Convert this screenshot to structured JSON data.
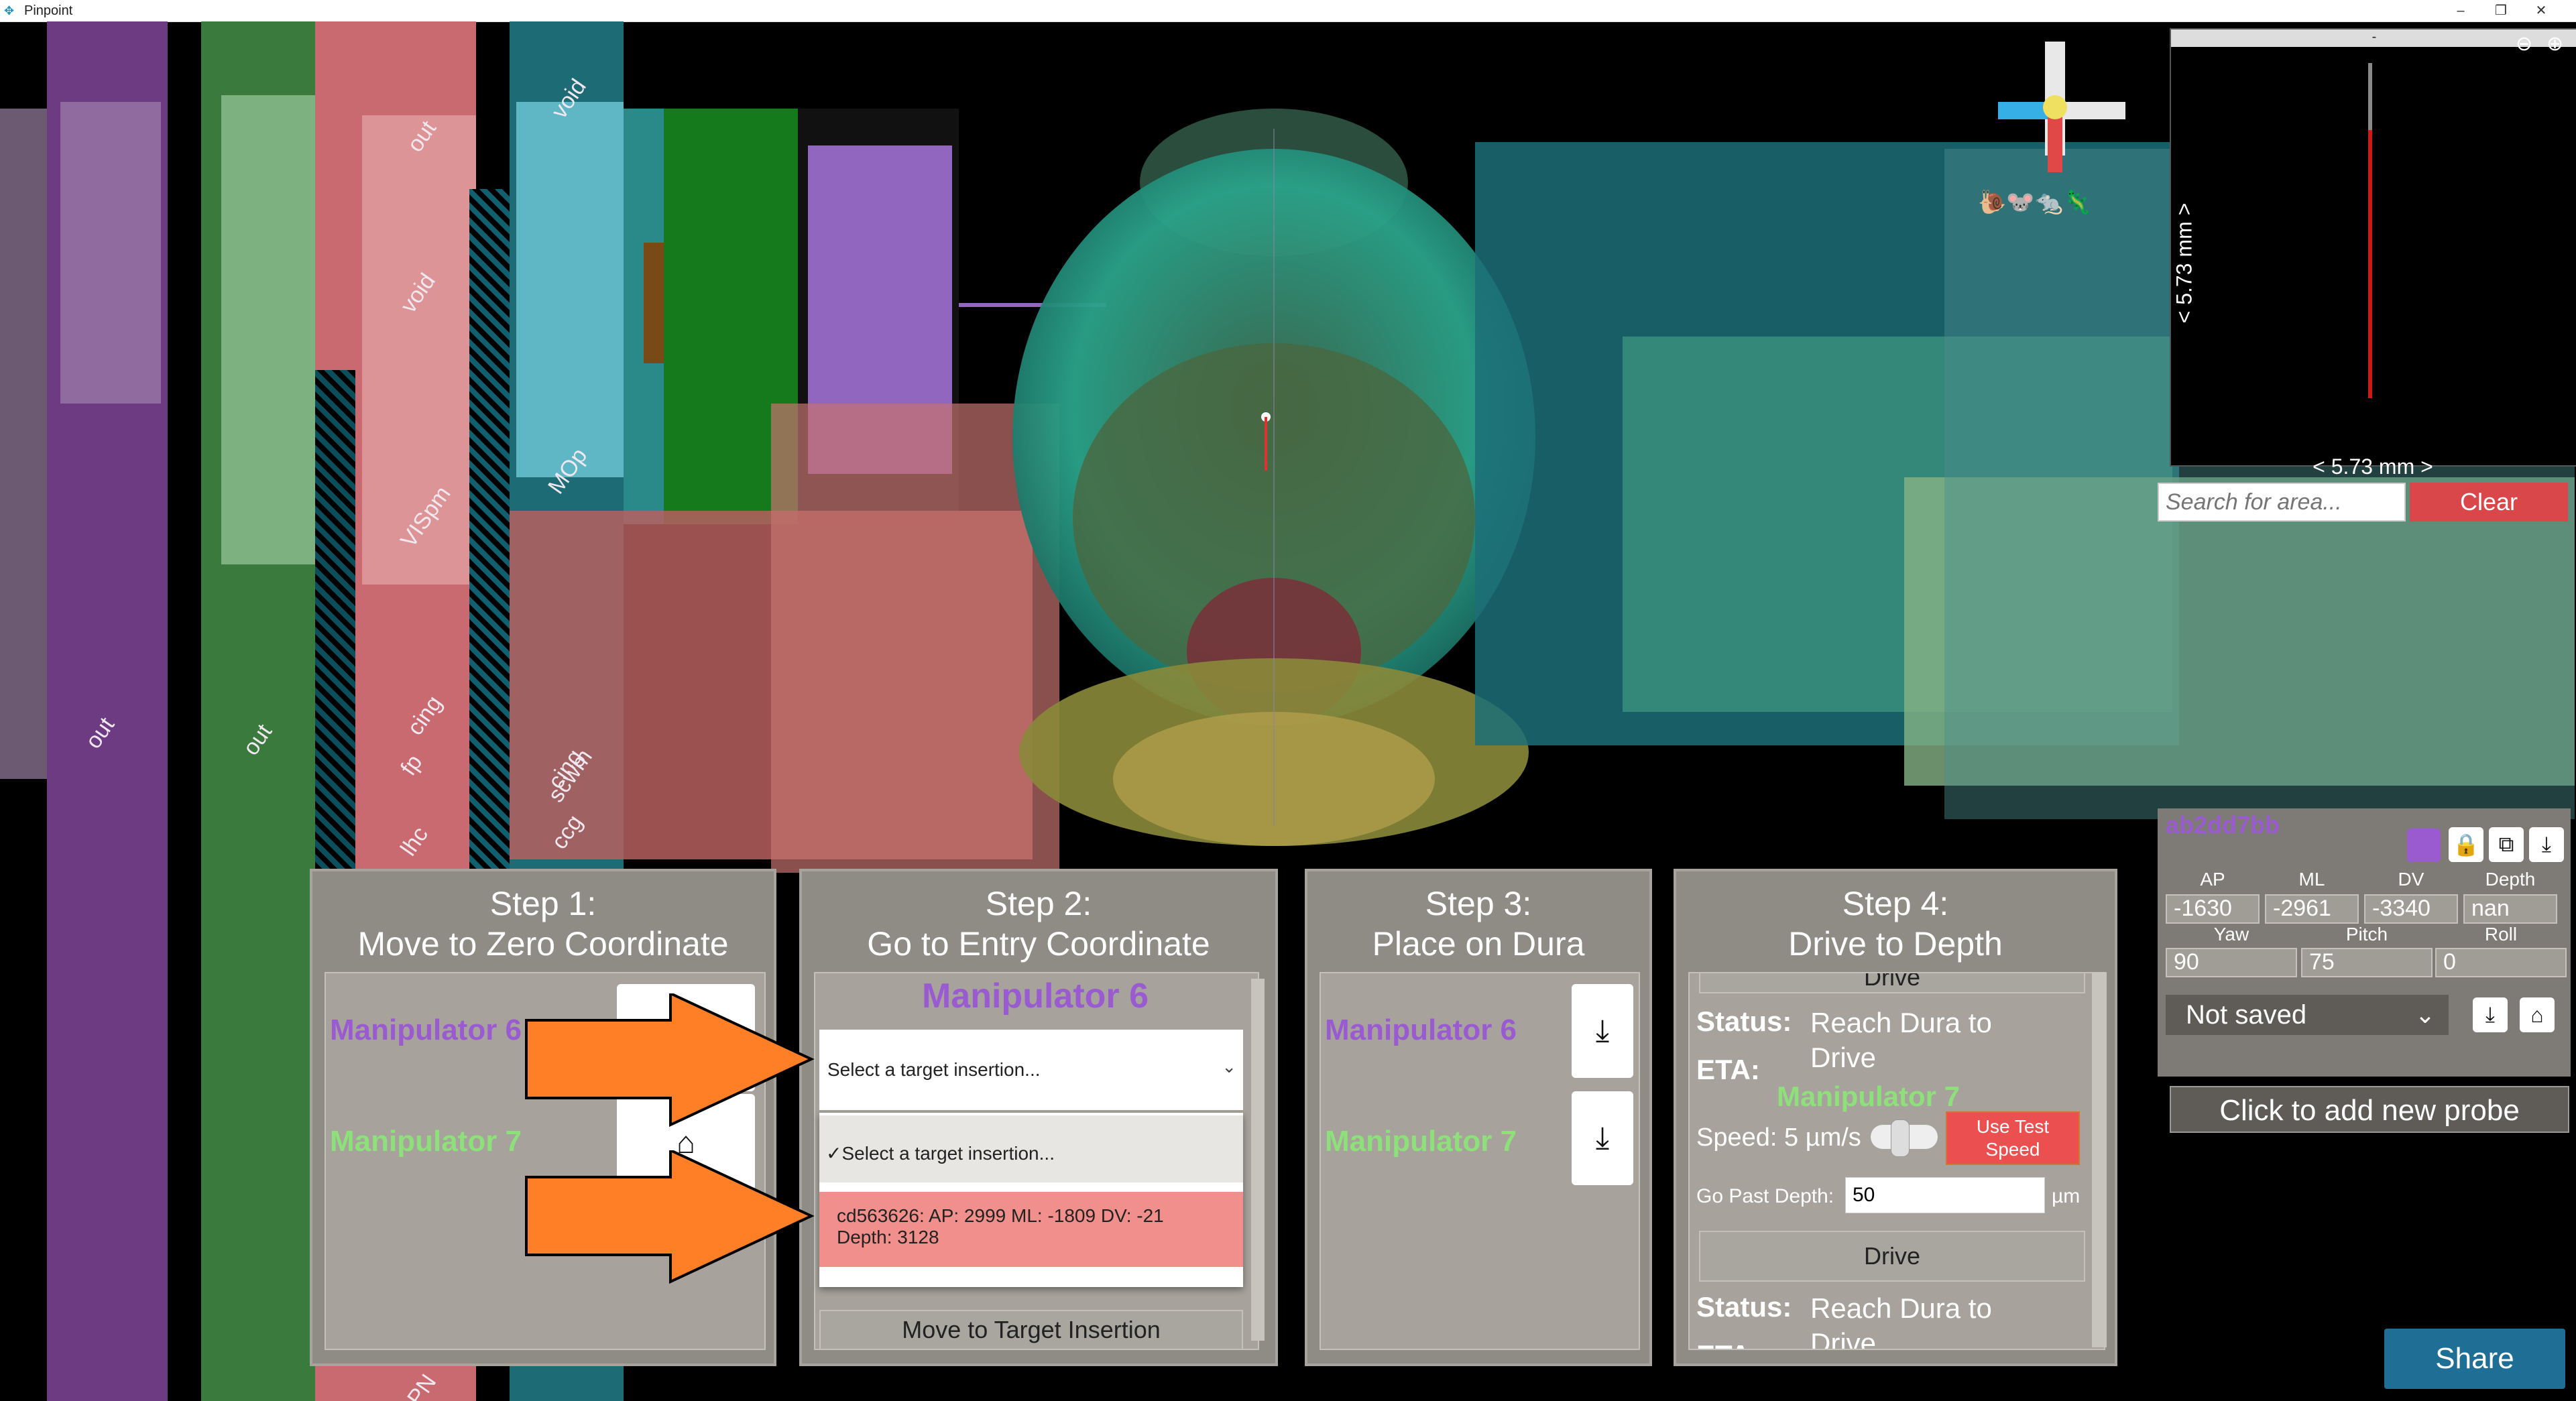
{
  "window": {
    "title": "Pinpoint",
    "icon": "pinpoint-app-icon"
  },
  "scene": {
    "labels": [
      "out",
      "void",
      "VISpm",
      "fp",
      "cing",
      "lhc",
      "out",
      "out",
      "void",
      "MOp",
      "ccg",
      "scwm",
      "cing",
      "PN"
    ]
  },
  "minimap": {
    "top_label": "-",
    "vertical_scale": "< 5.73 mm >",
    "horizontal_scale": "< 5.73 mm >"
  },
  "search": {
    "placeholder": "Search for area...",
    "clear_label": "Clear"
  },
  "probe": {
    "id": "ab2dd7bb",
    "color": "#9a5bd1",
    "coords_headers": [
      "AP",
      "ML",
      "DV",
      "Depth"
    ],
    "coords_values": [
      "-1630",
      "-2961",
      "-3340",
      "nan"
    ],
    "angle_headers": [
      "Yaw",
      "Pitch",
      "Roll"
    ],
    "angle_values": [
      "90",
      "75",
      "0"
    ],
    "save_status": "Not saved",
    "add_probe_label": "Click to add new probe"
  },
  "share_label": "Share",
  "steps": {
    "step1": {
      "title_line1": "Step 1:",
      "title_line2": "Move to Zero Coordinate",
      "m6": "Manipulator 6",
      "m7": "Manipulator 7"
    },
    "step2": {
      "title_line1": "Step 2:",
      "title_line2": "Go to Entry Coordinate",
      "manipulator": "Manipulator 6",
      "dropdown_value": "Select a target insertion...",
      "option_selected": "Select a target insertion...",
      "option_target_line1": "cd563626: AP: 2999 ML: -1809 DV: -21",
      "option_target_line2": "Depth: 3128",
      "move_button": "Move to Target Insertion"
    },
    "step3": {
      "title_line1": "Step 3:",
      "title_line2": "Place on Dura",
      "m6": "Manipulator 6",
      "m7": "Manipulator 7"
    },
    "step4": {
      "title_line1": "Step 4:",
      "title_line2": "Drive to Depth",
      "drive_top": "Drive",
      "status_label": "Status:",
      "status_value": "Reach Dura to Drive",
      "eta_label": "ETA:",
      "manipulator": "Manipulator 7",
      "speed_label": "Speed: 5 µm/s",
      "test_speed_label": "Use Test Speed",
      "past_depth_label": "Go Past Depth:",
      "past_depth_value": "50",
      "past_depth_unit": "µm",
      "drive_button": "Drive",
      "status2_label": "Status:",
      "status2_value": "Reach Dura to Drive",
      "eta2_label": "ETA:"
    }
  },
  "colors": {
    "manipulator6": "#9a5bd1",
    "manipulator7": "#8de07a",
    "clear": "#d9474a",
    "test_speed": "#ec4f4f",
    "share": "#1f6e95",
    "highlight": "#f08f8b",
    "arrow": "#ff7f26"
  }
}
